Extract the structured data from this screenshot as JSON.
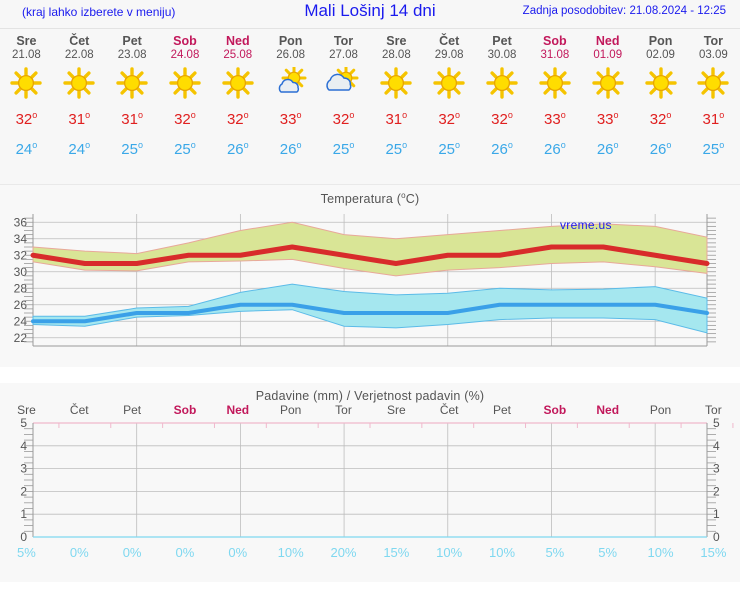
{
  "header": {
    "menu_note": "(kraj lahko izberete v meniju)",
    "place_title": "Mali Lošinj 14 dni",
    "updated": "Zadnja posodobitev: 21.08.2024 - 12:25"
  },
  "colors": {
    "link_blue": "#1a1aee",
    "weekend_red": "#c2185b",
    "tmax_red": "#e02020",
    "tmin_blue": "#3aa8e8",
    "band_green": "#d9e596",
    "band_green_edge": "#e8a89a",
    "line_red": "#d82b2b",
    "band_cyan": "#a5e7ef",
    "line_blue": "#3aa0e8",
    "grid": "#bdbdbd",
    "panel_bg": "#f8f8f8",
    "precip_pct": "#7fd8f0",
    "precip_top_line": "#f0b8cc"
  },
  "days": [
    {
      "dow": "Sre",
      "date": "21.08",
      "weekend": false,
      "icon": "sun-icon",
      "tmax": "32",
      "tmin": "24"
    },
    {
      "dow": "Čet",
      "date": "22.08",
      "weekend": false,
      "icon": "sun-icon",
      "tmax": "31",
      "tmin": "24"
    },
    {
      "dow": "Pet",
      "date": "23.08",
      "weekend": false,
      "icon": "sun-icon",
      "tmax": "31",
      "tmin": "25"
    },
    {
      "dow": "Sob",
      "date": "24.08",
      "weekend": true,
      "icon": "sun-icon",
      "tmax": "32",
      "tmin": "25"
    },
    {
      "dow": "Ned",
      "date": "25.08",
      "weekend": true,
      "icon": "sun-icon",
      "tmax": "32",
      "tmin": "26"
    },
    {
      "dow": "Pon",
      "date": "26.08",
      "weekend": false,
      "icon": "sun-small-cloud-icon",
      "tmax": "33",
      "tmin": "26"
    },
    {
      "dow": "Tor",
      "date": "27.08",
      "weekend": false,
      "icon": "sun-cloud-icon",
      "tmax": "32",
      "tmin": "25"
    },
    {
      "dow": "Sre",
      "date": "28.08",
      "weekend": false,
      "icon": "sun-icon",
      "tmax": "31",
      "tmin": "25"
    },
    {
      "dow": "Čet",
      "date": "29.08",
      "weekend": false,
      "icon": "sun-icon",
      "tmax": "32",
      "tmin": "25"
    },
    {
      "dow": "Pet",
      "date": "30.08",
      "weekend": false,
      "icon": "sun-icon",
      "tmax": "32",
      "tmin": "26"
    },
    {
      "dow": "Sob",
      "date": "31.08",
      "weekend": true,
      "icon": "sun-icon",
      "tmax": "33",
      "tmin": "26"
    },
    {
      "dow": "Ned",
      "date": "01.09",
      "weekend": true,
      "icon": "sun-icon",
      "tmax": "33",
      "tmin": "26"
    },
    {
      "dow": "Pon",
      "date": "02.09",
      "weekend": false,
      "icon": "sun-icon",
      "tmax": "32",
      "tmin": "26"
    },
    {
      "dow": "Tor",
      "date": "03.09",
      "weekend": false,
      "icon": "sun-icon",
      "tmax": "31",
      "tmin": "25"
    }
  ],
  "temperature_chart": {
    "title_main": "Temperatura (",
    "title_sup": "o",
    "title_tail": "C)",
    "watermark": "vreme.us",
    "y_ticks": [
      "36",
      "34",
      "32",
      "30",
      "28",
      "26",
      "24",
      "22"
    ]
  },
  "precip_chart": {
    "title": "Padavine (mm) / Verjetnost padavin (%)",
    "y_ticks": [
      "5",
      "4",
      "3",
      "2",
      "1",
      "0"
    ],
    "day_labels": [
      "Sre",
      "Čet",
      "Pet",
      "Sob",
      "Ned",
      "Pon",
      "Tor",
      "Sre",
      "Čet",
      "Pet",
      "Sob",
      "Ned",
      "Pon",
      "Tor"
    ],
    "weekend_flags": [
      false,
      false,
      false,
      true,
      true,
      false,
      false,
      false,
      false,
      false,
      true,
      true,
      false,
      false
    ],
    "percentages": [
      "5%",
      "0%",
      "0%",
      "0%",
      "0%",
      "10%",
      "20%",
      "15%",
      "10%",
      "10%",
      "5%",
      "5%",
      "10%",
      "15%"
    ]
  },
  "chart_data": [
    {
      "type": "line",
      "title": "Temperatura (oC)",
      "xlabel": "",
      "ylabel": "",
      "ylim": [
        21,
        37
      ],
      "grid": true,
      "legend": "none",
      "categories": [
        "21.08",
        "22.08",
        "23.08",
        "24.08",
        "25.08",
        "26.08",
        "27.08",
        "28.08",
        "29.08",
        "30.08",
        "31.08",
        "01.09",
        "02.09",
        "03.09"
      ],
      "series": [
        {
          "name": "Max temperatura",
          "values": [
            32,
            31,
            31,
            32,
            32,
            33,
            32,
            31,
            32,
            32,
            33,
            33,
            32,
            31
          ]
        },
        {
          "name": "Max pas zgornja meja",
          "values": [
            33,
            32.5,
            32.2,
            33.5,
            35,
            36,
            34.5,
            34,
            34.5,
            35,
            35.5,
            35.8,
            35.5,
            34.2
          ]
        },
        {
          "name": "Max pas spodnja meja",
          "values": [
            31.2,
            30.2,
            30.1,
            31.2,
            31.3,
            31.5,
            30.4,
            29.5,
            30.2,
            30.5,
            31,
            31.2,
            30.6,
            29.8
          ]
        },
        {
          "name": "Min temperatura",
          "values": [
            24,
            24,
            25,
            25,
            26,
            26,
            25,
            25,
            25,
            26,
            26,
            26,
            26,
            25
          ]
        },
        {
          "name": "Min pas zgornja meja",
          "values": [
            24.6,
            24.6,
            25.6,
            25.8,
            27.5,
            28.5,
            27.6,
            27.2,
            27.4,
            28,
            27.8,
            27.9,
            28.2,
            26.8
          ]
        },
        {
          "name": "Min pas spodnja meja",
          "values": [
            23.6,
            23.4,
            24.5,
            24.7,
            25.2,
            25.4,
            23.4,
            23.2,
            23.6,
            24.2,
            24.4,
            24.4,
            24.2,
            22.6
          ]
        }
      ]
    },
    {
      "type": "bar",
      "title": "Padavine (mm) / Verjetnost padavin (%)",
      "xlabel": "",
      "ylabel": "",
      "ylim": [
        0,
        5
      ],
      "grid": true,
      "categories": [
        "Sre",
        "Čet",
        "Pet",
        "Sob",
        "Ned",
        "Pon",
        "Tor",
        "Sre",
        "Čet",
        "Pet",
        "Sob",
        "Ned",
        "Pon",
        "Tor"
      ],
      "series": [
        {
          "name": "Padavine (mm)",
          "values": [
            0,
            0,
            0,
            0,
            0,
            0,
            0,
            0,
            0,
            0,
            0,
            0,
            0,
            0
          ]
        },
        {
          "name": "Verjetnost padavin (%)",
          "values": [
            5,
            0,
            0,
            0,
            0,
            10,
            20,
            15,
            10,
            10,
            5,
            5,
            10,
            15
          ]
        }
      ]
    }
  ]
}
